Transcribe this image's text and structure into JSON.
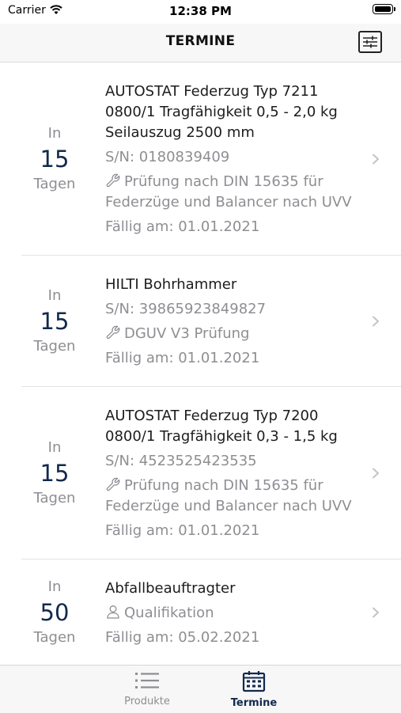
{
  "status_bar": {
    "carrier": "Carrier",
    "time": "12:38 PM"
  },
  "header": {
    "title": "TERMINE"
  },
  "items": [
    {
      "due_prefix": "In",
      "due_value": "15",
      "due_unit": "Tagen",
      "title": "AUTOSTAT Federzug Typ 7211 0800/1 Tragfähigkeit 0,5 - 2,0 kg Seilauszug 2500 mm",
      "serial": "S/N: 0180839409",
      "task_icon": "wrench-icon",
      "task": "Prüfung nach DIN 15635 für Federzüge und Balancer nach UVV",
      "due_date": "Fällig am: 01.01.2021"
    },
    {
      "due_prefix": "In",
      "due_value": "15",
      "due_unit": "Tagen",
      "title": "HILTI Bohrhammer",
      "serial": "S/N: 39865923849827",
      "task_icon": "wrench-icon",
      "task": "DGUV V3 Prüfung",
      "due_date": "Fällig am: 01.01.2021"
    },
    {
      "due_prefix": "In",
      "due_value": "15",
      "due_unit": "Tagen",
      "title": "AUTOSTAT Federzug Typ 7200 0800/1 Tragfähigkeit 0,3 - 1,5 kg",
      "serial": "S/N: 4523525423535",
      "task_icon": "wrench-icon",
      "task": "Prüfung nach DIN 15635 für Federzüge und Balancer nach UVV",
      "due_date": "Fällig am: 01.01.2021"
    },
    {
      "due_prefix": "In",
      "due_value": "50",
      "due_unit": "Tagen",
      "title": "Abfallbeauftragter",
      "task_icon": "person-icon",
      "task": "Qualifikation",
      "due_date": "Fällig am: 05.02.2021"
    }
  ],
  "tab_bar": {
    "tabs": [
      {
        "label": "Produkte",
        "icon": "list-icon",
        "selected": false
      },
      {
        "label": "Termine",
        "icon": "calendar-icon",
        "selected": true
      }
    ]
  },
  "colors": {
    "accent": "#12294d",
    "secondary_text": "#8e8e93",
    "bar_background": "#f7f7f7"
  }
}
